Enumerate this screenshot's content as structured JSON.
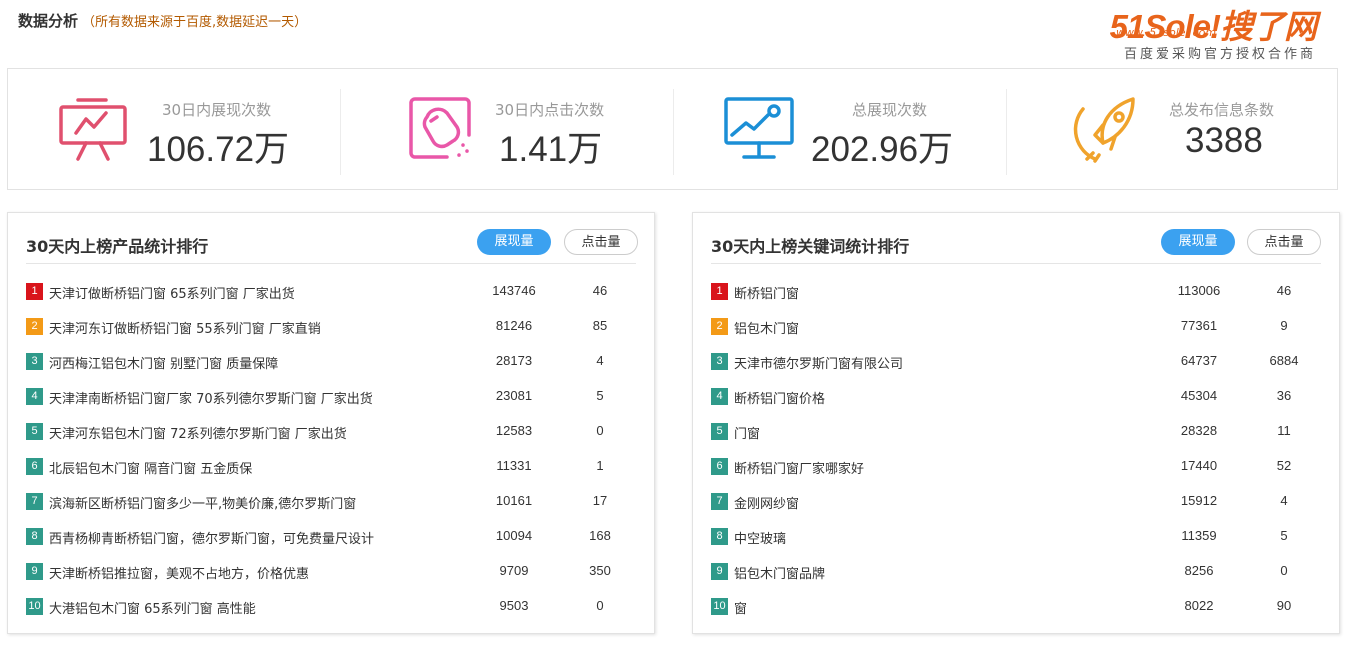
{
  "header": {
    "title": "数据分析",
    "note": "（所有数据来源于百度,数据延迟一天）"
  },
  "logo": {
    "mark": "51Sole!搜了网",
    "url": "www. 51sole. com",
    "slogan": "百度爱采购官方授权合作商"
  },
  "stats": [
    {
      "label": "30日内展现次数",
      "value": "106.72万",
      "icon": "presentation-chart-icon",
      "color": "#e0506e"
    },
    {
      "label": "30日内点击次数",
      "value": "1.41万",
      "icon": "mouse-click-icon",
      "color": "#e957a8"
    },
    {
      "label": "总展现次数",
      "value": "202.96万",
      "icon": "monitor-growth-icon",
      "color": "#1b8fd6"
    },
    {
      "label": "总发布信息条数",
      "value": "3388",
      "icon": "rocket-icon",
      "color": "#f0a32c"
    }
  ],
  "product_panel": {
    "title": "30天内上榜产品统计排行",
    "btn_active": "展现量",
    "btn_plain": "点击量",
    "rows": [
      {
        "rank": "1",
        "name": "天津订做断桥铝门窗 65系列门窗 厂家出货",
        "impressions": "143746",
        "clicks": "46"
      },
      {
        "rank": "2",
        "name": "天津河东订做断桥铝门窗 55系列门窗 厂家直销",
        "impressions": "81246",
        "clicks": "85"
      },
      {
        "rank": "3",
        "name": "河西梅江铝包木门窗 别墅门窗 质量保障",
        "impressions": "28173",
        "clicks": "4"
      },
      {
        "rank": "4",
        "name": "天津津南断桥铝门窗厂家 70系列德尔罗斯门窗 厂家出货",
        "impressions": "23081",
        "clicks": "5"
      },
      {
        "rank": "5",
        "name": "天津河东铝包木门窗 72系列德尔罗斯门窗 厂家出货",
        "impressions": "12583",
        "clicks": "0"
      },
      {
        "rank": "6",
        "name": "北辰铝包木门窗 隔音门窗 五金质保",
        "impressions": "11331",
        "clicks": "1"
      },
      {
        "rank": "7",
        "name": "滨海新区断桥铝门窗多少一平,物美价廉,德尔罗斯门窗",
        "impressions": "10161",
        "clicks": "17"
      },
      {
        "rank": "8",
        "name": "西青杨柳青断桥铝门窗，德尔罗斯门窗，可免费量尺设计",
        "impressions": "10094",
        "clicks": "168"
      },
      {
        "rank": "9",
        "name": "天津断桥铝推拉窗，美观不占地方，价格优惠",
        "impressions": "9709",
        "clicks": "350"
      },
      {
        "rank": "10",
        "name": "大港铝包木门窗 65系列门窗 高性能",
        "impressions": "9503",
        "clicks": "0"
      }
    ]
  },
  "keyword_panel": {
    "title": "30天内上榜关键词统计排行",
    "btn_active": "展现量",
    "btn_plain": "点击量",
    "rows": [
      {
        "rank": "1",
        "name": "断桥铝门窗",
        "impressions": "113006",
        "clicks": "46"
      },
      {
        "rank": "2",
        "name": "铝包木门窗",
        "impressions": "77361",
        "clicks": "9"
      },
      {
        "rank": "3",
        "name": "天津市德尔罗斯门窗有限公司",
        "impressions": "64737",
        "clicks": "6884"
      },
      {
        "rank": "4",
        "name": "断桥铝门窗价格",
        "impressions": "45304",
        "clicks": "36"
      },
      {
        "rank": "5",
        "name": "门窗",
        "impressions": "28328",
        "clicks": "11"
      },
      {
        "rank": "6",
        "name": "断桥铝门窗厂家哪家好",
        "impressions": "17440",
        "clicks": "52"
      },
      {
        "rank": "7",
        "name": "金刚网纱窗",
        "impressions": "15912",
        "clicks": "4"
      },
      {
        "rank": "8",
        "name": "中空玻璃",
        "impressions": "11359",
        "clicks": "5"
      },
      {
        "rank": "9",
        "name": "铝包木门窗品牌",
        "impressions": "8256",
        "clicks": "0"
      },
      {
        "rank": "10",
        "name": "窗",
        "impressions": "8022",
        "clicks": "90"
      }
    ]
  }
}
